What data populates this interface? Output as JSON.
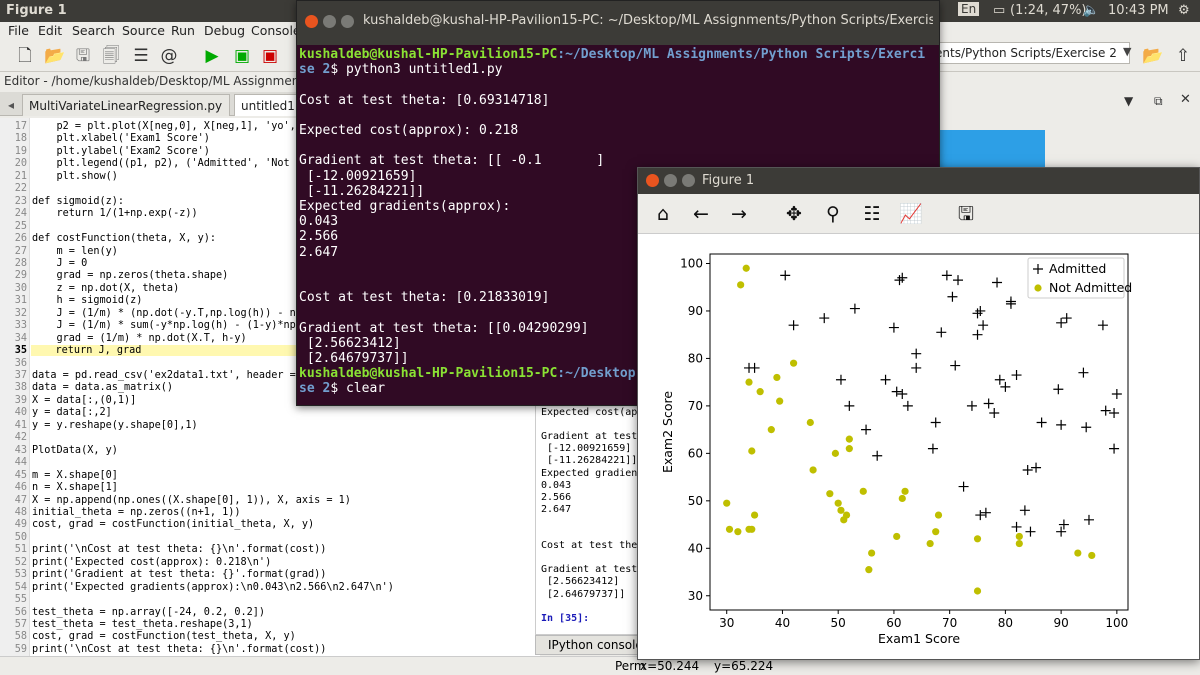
{
  "topbar": {
    "window_title": "Figure 1",
    "lang": "En",
    "battery": "(1:24, 47%)",
    "time": "10:43 PM"
  },
  "menu": [
    "File",
    "Edit",
    "Search",
    "Source",
    "Run",
    "Debug",
    "Consoles"
  ],
  "editor": {
    "title": "Editor - /home/kushaldeb/Desktop/ML Assignments/Pyth",
    "tabs": [
      {
        "label": "MultiVariateLinearRegression.py",
        "close": "✕"
      },
      {
        "label": "untitled1.p"
      }
    ],
    "lines": [
      {
        "n": "17",
        "t": "    p2 = plt.plot(X[neg,0], X[neg,1], 'yo', mar"
      },
      {
        "n": "18",
        "t": "    plt.xlabel('Exam1 Score')"
      },
      {
        "n": "19",
        "t": "    plt.ylabel('Exam2 Score')"
      },
      {
        "n": "20",
        "t": "    plt.legend((p1, p2), ('Admitted', 'Not Adm"
      },
      {
        "n": "21",
        "t": "    plt.show()"
      },
      {
        "n": "22",
        "t": ""
      },
      {
        "n": "23",
        "t": "def sigmoid(z):"
      },
      {
        "n": "24",
        "t": "    return 1/(1+np.exp(-z))"
      },
      {
        "n": "25",
        "t": ""
      },
      {
        "n": "26",
        "t": "def costFunction(theta, X, y):"
      },
      {
        "n": "27",
        "t": "    m = len(y)"
      },
      {
        "n": "28",
        "t": "    J = 0"
      },
      {
        "n": "29",
        "t": "    grad = np.zeros(theta.shape)"
      },
      {
        "n": "30",
        "t": "    z = np.dot(X, theta)"
      },
      {
        "n": "31",
        "t": "    h = sigmoid(z)"
      },
      {
        "n": "32",
        "t": "    J = (1/m) * (np.dot(-y.T,np.log(h)) - np.do"
      },
      {
        "n": "33",
        "t": "    J = (1/m) * sum(-y*np.log(h) - (1-y)*np.lo"
      },
      {
        "n": "34",
        "t": "    grad = (1/m) * np.dot(X.T, h-y)"
      },
      {
        "n": "35",
        "t": "    return J, grad"
      },
      {
        "n": "36",
        "t": ""
      },
      {
        "n": "37",
        "t": "data = pd.read_csv('ex2data1.txt', header = No"
      },
      {
        "n": "38",
        "t": "data = data.as_matrix()"
      },
      {
        "n": "39",
        "t": "X = data[:,(0,1)]"
      },
      {
        "n": "40",
        "t": "y = data[:,2]"
      },
      {
        "n": "41",
        "t": "y = y.reshape(y.shape[0],1)"
      },
      {
        "n": "42",
        "t": ""
      },
      {
        "n": "43",
        "t": "PlotData(X, y)"
      },
      {
        "n": "44",
        "t": ""
      },
      {
        "n": "45",
        "t": "m = X.shape[0]"
      },
      {
        "n": "46",
        "t": "n = X.shape[1]"
      },
      {
        "n": "47",
        "t": "X = np.append(np.ones((X.shape[0], 1)), X, axis = 1)"
      },
      {
        "n": "48",
        "t": "initial_theta = np.zeros((n+1, 1))"
      },
      {
        "n": "49",
        "t": "cost, grad = costFunction(initial_theta, X, y)"
      },
      {
        "n": "50",
        "t": ""
      },
      {
        "n": "51",
        "t": "print('\\nCost at test theta: {}\\n'.format(cost))"
      },
      {
        "n": "52",
        "t": "print('Expected cost(approx): 0.218\\n')"
      },
      {
        "n": "53",
        "t": "print('Gradient at test theta: {}'.format(grad))"
      },
      {
        "n": "54",
        "t": "print('Expected gradients(approx):\\n0.043\\n2.566\\n2.647\\n')"
      },
      {
        "n": "55",
        "t": ""
      },
      {
        "n": "56",
        "t": "test_theta = np.array([-24, 0.2, 0.2])"
      },
      {
        "n": "57",
        "t": "test_theta = test_theta.reshape(3,1)"
      },
      {
        "n": "58",
        "t": "cost, grad = costFunction(test_theta, X, y)"
      },
      {
        "n": "59",
        "t": "print('\\nCost at test theta: {}\\n'.format(cost))"
      }
    ]
  },
  "pathbox": "ents/Python Scripts/Exercise 2",
  "console": [
    "Expected cost(app",
    "",
    "Gradient at test",
    " [-12.00921659]",
    " [-11.26284221]]",
    "Expected gradient",
    "0.043",
    "2.566",
    "2.647",
    "",
    "",
    "Cost at test thet",
    "",
    "Gradient at test",
    " [2.56623412]",
    " [2.64679737]]",
    "",
    "In [35]:"
  ],
  "console_tab": "IPython console",
  "status": {
    "perm": "Perm",
    "x": "x=50.244",
    "y": "y=65.224"
  },
  "terminal": {
    "title": "kushaldeb@kushal-HP-Pavilion15-PC: ~/Desktop/ML Assignments/Python Scripts/Exercise",
    "prompt_user": "kushaldeb@kushal-HP-Pavilion15-PC",
    "prompt_path1": ":~/Desktop/ML Assignments/Python Scripts/Exerci",
    "prompt_path1b": "se 2",
    "cmd1": "$ python3 untitled1.py",
    "out": [
      "",
      "Cost at test theta: [0.69314718]",
      "",
      "Expected cost(approx): 0.218",
      "",
      "Gradient at test theta: [[ -0.1       ]",
      " [-12.00921659]",
      " [-11.26284221]]",
      "Expected gradients(approx):",
      "0.043",
      "2.566",
      "2.647",
      "",
      "",
      "Cost at test theta: [0.21833019]",
      "",
      "Gradient at test theta: [[0.04290299]",
      " [2.56623412]",
      " [2.64679737]]"
    ],
    "prompt_path2": ":~/Desktop",
    "prompt_path2b": "se 2",
    "cmd2": "$ clear"
  },
  "figure": {
    "title": "Figure 1",
    "tools": [
      "home-icon",
      "back-icon",
      "forward-icon",
      "pan-icon",
      "zoom-icon",
      "subplots-icon",
      "axes-edit-icon",
      "save-icon"
    ]
  },
  "chart_data": {
    "type": "scatter",
    "xlabel": "Exam1 Score",
    "ylabel": "Exam2 Score",
    "xlim": [
      27,
      102
    ],
    "ylim": [
      27,
      102
    ],
    "xticks": [
      30,
      40,
      50,
      60,
      70,
      80,
      90,
      100
    ],
    "yticks": [
      30,
      40,
      50,
      60,
      70,
      80,
      90,
      100
    ],
    "legend_position": "top-right",
    "series": [
      {
        "name": "Admitted",
        "marker": "+",
        "color": "#000000",
        "points": [
          [
            40.5,
            97.5
          ],
          [
            42,
            87
          ],
          [
            47.5,
            88.5
          ],
          [
            50.5,
            75.5
          ],
          [
            53,
            90.5
          ],
          [
            52,
            70
          ],
          [
            55,
            65
          ],
          [
            57,
            59.5
          ],
          [
            58.5,
            75.5
          ],
          [
            60,
            86.5
          ],
          [
            61,
            96.5
          ],
          [
            61.5,
            97
          ],
          [
            60.5,
            73
          ],
          [
            61.5,
            72.5
          ],
          [
            62.5,
            70
          ],
          [
            64,
            81
          ],
          [
            64,
            78
          ],
          [
            67,
            61
          ],
          [
            67.5,
            66.5
          ],
          [
            68.5,
            85.5
          ],
          [
            69.5,
            97.5
          ],
          [
            70.5,
            93
          ],
          [
            71,
            78.5
          ],
          [
            71.5,
            96.5
          ],
          [
            72.5,
            53
          ],
          [
            74,
            70
          ],
          [
            75,
            89.5
          ],
          [
            75,
            85
          ],
          [
            75.5,
            90
          ],
          [
            76,
            87
          ],
          [
            75.5,
            47
          ],
          [
            76.5,
            47.5
          ],
          [
            77,
            70.5
          ],
          [
            78,
            68.5
          ],
          [
            79,
            75.5
          ],
          [
            80,
            74
          ],
          [
            78.5,
            96
          ],
          [
            81,
            92
          ],
          [
            81,
            91.5
          ],
          [
            82,
            76.5
          ],
          [
            83.5,
            48
          ],
          [
            84,
            56.5
          ],
          [
            85.5,
            57
          ],
          [
            86.5,
            66.5
          ],
          [
            90,
            87.5
          ],
          [
            91,
            88.5
          ],
          [
            89.5,
            73.5
          ],
          [
            90,
            66
          ],
          [
            90.5,
            45
          ],
          [
            90,
            43.5
          ],
          [
            94,
            77
          ],
          [
            94.5,
            65.5
          ],
          [
            95,
            46
          ],
          [
            97.5,
            87
          ],
          [
            98,
            69
          ],
          [
            99.5,
            68.5
          ],
          [
            100,
            72.5
          ],
          [
            99.5,
            61
          ],
          [
            82,
            44.5
          ],
          [
            84.5,
            43.5
          ],
          [
            35,
            78
          ],
          [
            34,
            78
          ]
        ]
      },
      {
        "name": "Not Admitted",
        "marker": "o",
        "color": "#bfbf00",
        "points": [
          [
            30,
            49.5
          ],
          [
            30.5,
            44
          ],
          [
            32.5,
            95.5
          ],
          [
            33.5,
            99
          ],
          [
            34,
            75
          ],
          [
            34,
            44
          ],
          [
            34.5,
            60.5
          ],
          [
            35,
            47
          ],
          [
            36,
            73
          ],
          [
            38,
            65
          ],
          [
            39,
            76
          ],
          [
            39.5,
            71
          ],
          [
            42,
            79
          ],
          [
            45,
            66.5
          ],
          [
            45.5,
            56.5
          ],
          [
            48.5,
            51.5
          ],
          [
            49.5,
            60
          ],
          [
            50,
            49.5
          ],
          [
            50.5,
            48
          ],
          [
            51,
            46
          ],
          [
            51.5,
            47
          ],
          [
            52,
            63
          ],
          [
            52,
            61
          ],
          [
            54.5,
            52
          ],
          [
            55.5,
            35.5
          ],
          [
            56,
            39
          ],
          [
            60.5,
            42.5
          ],
          [
            61.5,
            50.5
          ],
          [
            62,
            52
          ],
          [
            66.5,
            41
          ],
          [
            67.5,
            43.5
          ],
          [
            68,
            47
          ],
          [
            75,
            42
          ],
          [
            75,
            31
          ],
          [
            82.5,
            42.5
          ],
          [
            82.5,
            41
          ],
          [
            93,
            39
          ],
          [
            95.5,
            38.5
          ],
          [
            32,
            43.5
          ],
          [
            34.5,
            44
          ]
        ]
      }
    ]
  }
}
